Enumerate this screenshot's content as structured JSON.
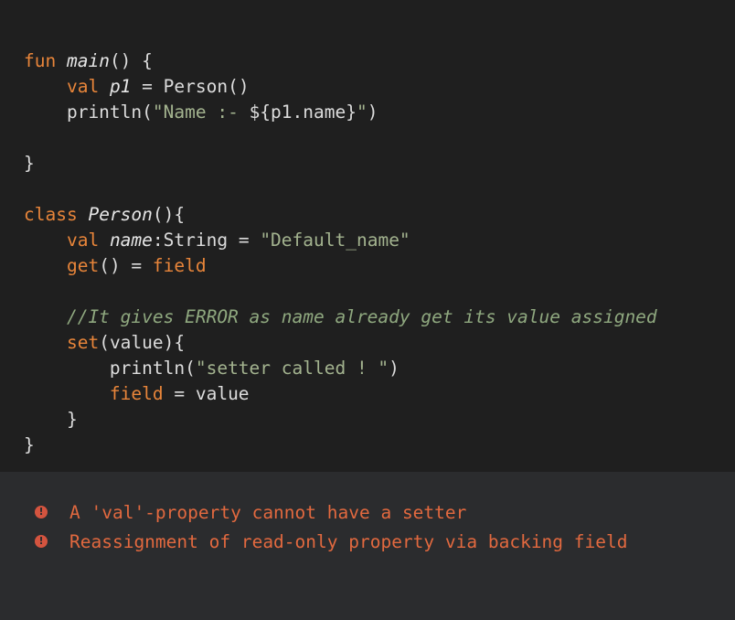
{
  "code": {
    "lines": [
      [
        {
          "t": "fun ",
          "c": "kw"
        },
        {
          "t": "main",
          "c": "fn"
        },
        {
          "t": "() {",
          "c": "plain"
        }
      ],
      [
        {
          "t": "    ",
          "c": "plain"
        },
        {
          "t": "val ",
          "c": "kw"
        },
        {
          "t": "p1",
          "c": "it"
        },
        {
          "t": " = Person()",
          "c": "plain"
        }
      ],
      [
        {
          "t": "    println(",
          "c": "plain"
        },
        {
          "t": "\"Name :- ",
          "c": "str"
        },
        {
          "t": "${p1.name}",
          "c": "plain"
        },
        {
          "t": "\"",
          "c": "str"
        },
        {
          "t": ")",
          "c": "plain"
        }
      ],
      [],
      [
        {
          "t": "}",
          "c": "plain"
        }
      ],
      [],
      [
        {
          "t": "class ",
          "c": "kw"
        },
        {
          "t": "Person",
          "c": "it"
        },
        {
          "t": "(){",
          "c": "plain"
        }
      ],
      [
        {
          "t": "    ",
          "c": "plain"
        },
        {
          "t": "val ",
          "c": "kw"
        },
        {
          "t": "name",
          "c": "it"
        },
        {
          "t": ":String = ",
          "c": "plain"
        },
        {
          "t": "\"Default_name\"",
          "c": "str"
        }
      ],
      [
        {
          "t": "    ",
          "c": "plain"
        },
        {
          "t": "get",
          "c": "kw"
        },
        {
          "t": "() = ",
          "c": "plain"
        },
        {
          "t": "field",
          "c": "kw"
        }
      ],
      [],
      [
        {
          "t": "    //It gives ERROR as name already get its value assigned",
          "c": "cm"
        }
      ],
      [
        {
          "t": "    ",
          "c": "plain"
        },
        {
          "t": "set",
          "c": "kw"
        },
        {
          "t": "(value){",
          "c": "plain"
        }
      ],
      [
        {
          "t": "        println(",
          "c": "plain"
        },
        {
          "t": "\"setter called ! \"",
          "c": "str"
        },
        {
          "t": ")",
          "c": "plain"
        }
      ],
      [
        {
          "t": "        ",
          "c": "plain"
        },
        {
          "t": "field",
          "c": "kw"
        },
        {
          "t": " = value",
          "c": "plain"
        }
      ],
      [
        {
          "t": "    }",
          "c": "plain"
        }
      ],
      [
        {
          "t": "}",
          "c": "plain"
        }
      ]
    ]
  },
  "problems": {
    "icon": "error-icon",
    "icon_glyph": "!",
    "error_color": "#e2693f",
    "items": [
      "A 'val'-property cannot have a setter",
      "Reassignment of read-only property via backing field"
    ]
  },
  "colors": {
    "editor_bg": "#1f1f1f",
    "panel_bg": "#2b2c2e",
    "keyword": "#e8853a",
    "string": "#a3b38f",
    "comment": "#8fa87f"
  }
}
